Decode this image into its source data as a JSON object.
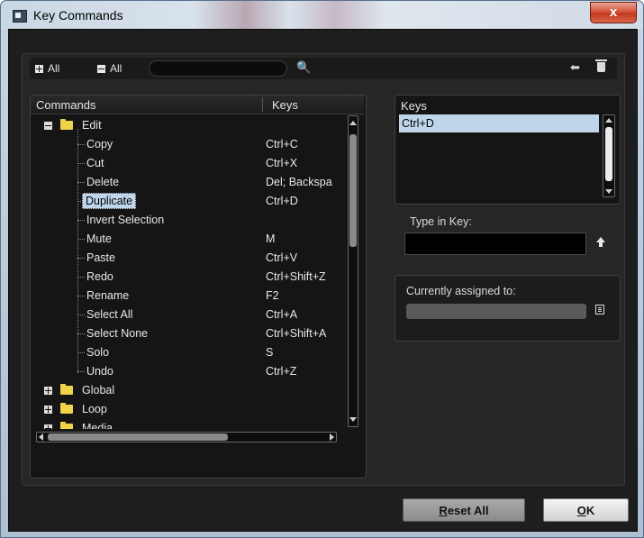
{
  "window": {
    "title": "Key Commands",
    "close_label": "x"
  },
  "toolbar": {
    "expand_label": "All",
    "collapse_label": "All",
    "search_value": ""
  },
  "commands": {
    "header_commands": "Commands",
    "header_keys": "Keys",
    "edit_folder": "Edit",
    "items": [
      {
        "label": "Copy",
        "key": "Ctrl+C"
      },
      {
        "label": "Cut",
        "key": "Ctrl+X"
      },
      {
        "label": "Delete",
        "key": "Del; Backspa"
      },
      {
        "label": "Duplicate",
        "key": "Ctrl+D"
      },
      {
        "label": "Invert Selection",
        "key": ""
      },
      {
        "label": "Mute",
        "key": "M"
      },
      {
        "label": "Paste",
        "key": "Ctrl+V"
      },
      {
        "label": "Redo",
        "key": "Ctrl+Shift+Z"
      },
      {
        "label": "Rename",
        "key": "F2"
      },
      {
        "label": "Select All",
        "key": "Ctrl+A"
      },
      {
        "label": "Select None",
        "key": "Ctrl+Shift+A"
      },
      {
        "label": "Solo",
        "key": "S"
      },
      {
        "label": "Undo",
        "key": "Ctrl+Z"
      }
    ],
    "folders": [
      "Global",
      "Loop",
      "Media"
    ]
  },
  "keys_panel": {
    "header": "Keys",
    "items": [
      "Ctrl+D"
    ]
  },
  "type_in_key": {
    "label": "Type in Key:",
    "value": ""
  },
  "assigned": {
    "label": "Currently assigned to:",
    "value": ""
  },
  "buttons": {
    "reset_prefix": "R",
    "reset_rest": "eset All",
    "ok_prefix": "O",
    "ok_rest": "K"
  },
  "colors": {
    "selection": "#bfd6ea",
    "folder": "#f1d34a",
    "dialog_bg": "#1e1e1e"
  }
}
